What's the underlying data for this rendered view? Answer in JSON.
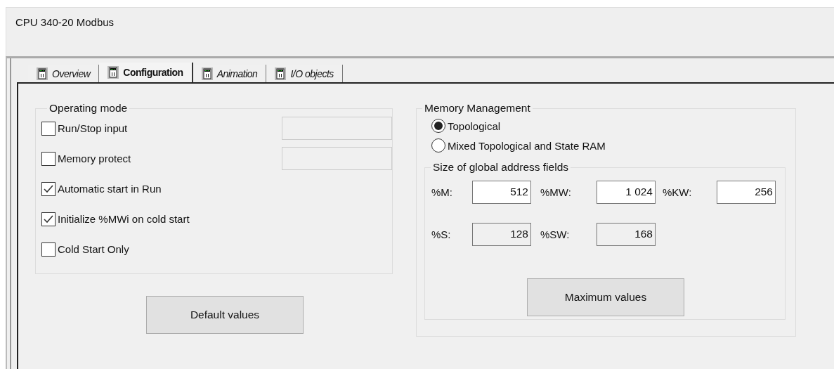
{
  "window": {
    "title": "CPU 340-20 Modbus"
  },
  "tabs": [
    {
      "label": "Overview",
      "selected": false
    },
    {
      "label": "Configuration",
      "selected": true
    },
    {
      "label": "Animation",
      "selected": false
    },
    {
      "label": "I/O objects",
      "selected": false
    }
  ],
  "operating_mode": {
    "title": "Operating mode",
    "options": [
      {
        "label": "Run/Stop input",
        "checked": false,
        "kind": "with_field"
      },
      {
        "label": "Memory protect",
        "checked": false,
        "kind": "with_field"
      },
      {
        "label": "Automatic start in Run",
        "checked": true,
        "kind": "plain"
      },
      {
        "label": "Initialize %MWi on cold start",
        "checked": true,
        "kind": "plain"
      },
      {
        "label": "Cold Start Only",
        "checked": false,
        "kind": "plain"
      }
    ],
    "button": "Default values"
  },
  "memory_management": {
    "title": "Memory Management",
    "options": [
      {
        "label": "Topological",
        "selected": true
      },
      {
        "label": "Mixed Topological and State RAM",
        "selected": false
      }
    ],
    "address_fields": {
      "title": "Size of global address fields",
      "rows": [
        [
          {
            "label": "%M:",
            "value": "512",
            "disabled": false
          },
          {
            "label": "%MW:",
            "value": "1 024",
            "disabled": false
          },
          {
            "label": "%KW:",
            "value": "256",
            "disabled": false
          }
        ],
        [
          {
            "label": "%S:",
            "value": "128",
            "disabled": true
          },
          {
            "label": "%SW:",
            "value": "168",
            "disabled": true
          }
        ]
      ]
    },
    "button": "Maximum values"
  }
}
